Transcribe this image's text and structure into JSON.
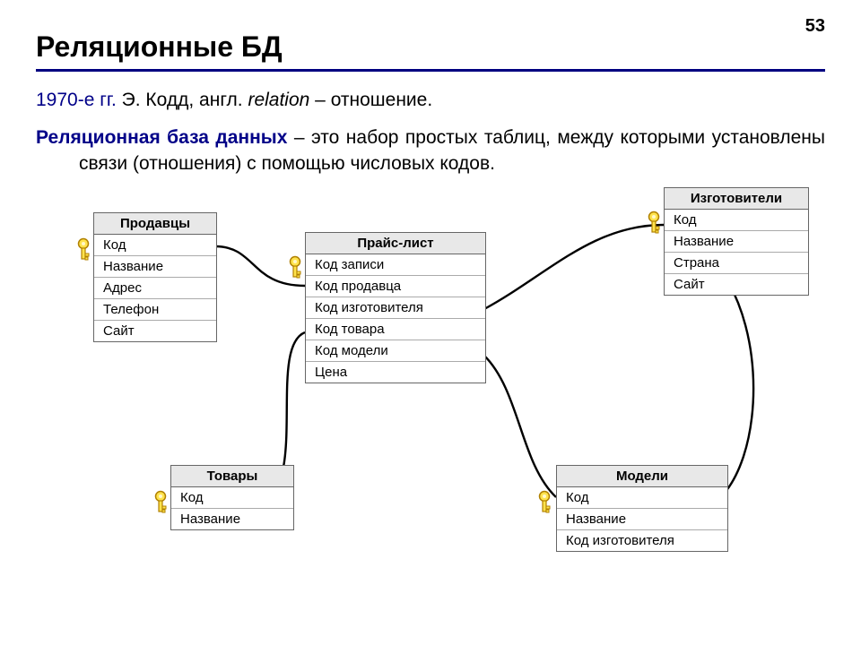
{
  "page_number": "53",
  "title": "Реляционные БД",
  "intro": {
    "lead": "1970-е гг.",
    "rest1": " Э. Кодд, англ. ",
    "italic": "relation",
    "rest2": " – отношение."
  },
  "definition": {
    "lead": "Реляционная база данных",
    "rest": " – это набор простых таблиц, между которыми установлены связи (отношения) с помощью числовых кодов."
  },
  "entities": {
    "sellers": {
      "title": "Продавцы",
      "fields": [
        "Код",
        "Название",
        "Адрес",
        "Телефон",
        "Сайт"
      ]
    },
    "pricelist": {
      "title": "Прайс-лист",
      "fields": [
        "Код записи",
        "Код продавца",
        "Код изготовителя",
        "Код товара",
        "Код модели",
        "Цена"
      ]
    },
    "manufacturers": {
      "title": "Изготовители",
      "fields": [
        "Код",
        "Название",
        "Страна",
        "Сайт"
      ]
    },
    "goods": {
      "title": "Товары",
      "fields": [
        "Код",
        "Название"
      ]
    },
    "models": {
      "title": "Модели",
      "fields": [
        "Код",
        "Название",
        "Код изготовителя"
      ]
    }
  }
}
